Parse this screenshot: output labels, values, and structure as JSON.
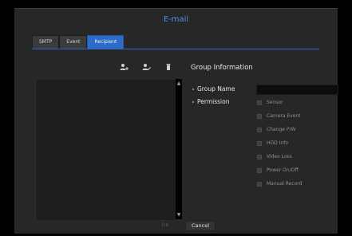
{
  "dialog": {
    "title": "E-mail",
    "tabs": [
      {
        "label": "SMTP"
      },
      {
        "label": "Event"
      },
      {
        "label": "Recipient"
      }
    ]
  },
  "toolbar": {
    "icons": [
      "add-group-icon",
      "edit-group-icon",
      "delete-icon"
    ]
  },
  "group": {
    "heading": "Group Information",
    "name_label": "Group Name",
    "name_value": "",
    "permission_label": "Permission",
    "permissions": [
      "Sensor",
      "Camera Event",
      "Change P/W",
      "HDD Info",
      "Video Loss",
      "Power On/Off",
      "Manual Record"
    ]
  },
  "buttons": {
    "ok": "OK",
    "cancel": "Cancel"
  },
  "colors": {
    "accent": "#2e6ac7",
    "title": "#4f8fe6",
    "panel": "#272727"
  }
}
